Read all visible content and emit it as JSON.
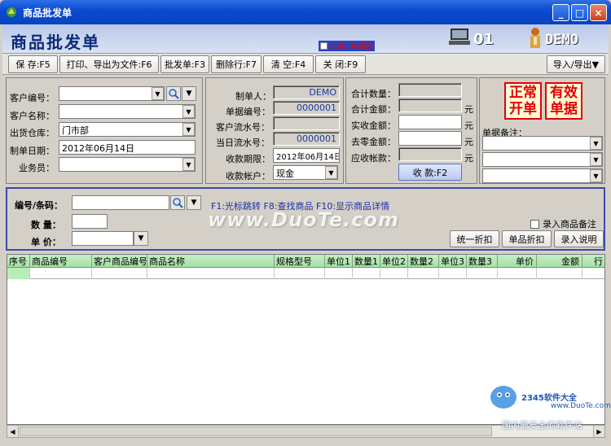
{
  "window": {
    "title": "商品批发单",
    "min_glyph": "_",
    "max_glyph": "□",
    "close_glyph": "×"
  },
  "header": {
    "title": "商品批发单",
    "price_check_label": "记录价格跟踪",
    "terminal_no": "01",
    "user": "DEMO"
  },
  "toolbar": {
    "save": "保 存:F5",
    "print": "打印、导出为文件:F6",
    "wholesale": "批发单:F3",
    "delete_row": "删除行:F7",
    "clear": "清 空:F4",
    "close": "关 闭:F9",
    "import_export": "导入/导出▼"
  },
  "customer": {
    "code_label": "客户编号：",
    "name_label": "客户名称：",
    "warehouse_label": "出货仓库：",
    "warehouse_value": "门市部",
    "date_label": "制单日期：",
    "date_value": "2012年06月14日",
    "salesman_label": "业务员："
  },
  "doc": {
    "maker_label": "制单人：",
    "maker_value": "DEMO",
    "doc_no_label": "单据编号：",
    "doc_no_value": "0000001",
    "cust_serial_label": "客户流水号：",
    "cust_serial_value": "",
    "day_serial_label": "当日流水号：",
    "day_serial_value": "0000001",
    "due_label": "收款期限：",
    "due_value": "2012年06月14日",
    "account_label": "收款帐户：",
    "account_value": "现金"
  },
  "totals": {
    "qty_label": "合计数量：",
    "amount_label": "合计金额：",
    "received_label": "实收金额：",
    "rounding_label": "去零金额：",
    "receivable_label": "应收帐款：",
    "unit": "元",
    "collect_btn": "收 款:F2"
  },
  "stamps": {
    "normal": "正常开单",
    "valid": "有效单据",
    "note_label": "单据备注："
  },
  "entry": {
    "code_label": "编号/条码：",
    "qty_label": "数 量：",
    "price_label": "单 价：",
    "hint": "F1:光标跳转  F8:查找商品  F10:显示商品详情",
    "note_check": "录入商品备注",
    "discount_all": "统一折扣",
    "discount_item": "单品折扣",
    "entry_help": "录入说明"
  },
  "grid": {
    "columns": [
      "序号",
      "商品编号",
      "客户商品编号",
      "商品名称",
      "规格型号",
      "单位1",
      "数量1",
      "单位2",
      "数量2",
      "单位3",
      "数量3",
      "单价",
      "金额",
      "行"
    ]
  },
  "watermarks": {
    "main": "www.DuoTe.com",
    "brand": "2345软件大全",
    "site": "www.DuoTe.com",
    "slogan": "国内最安全的软件站"
  }
}
